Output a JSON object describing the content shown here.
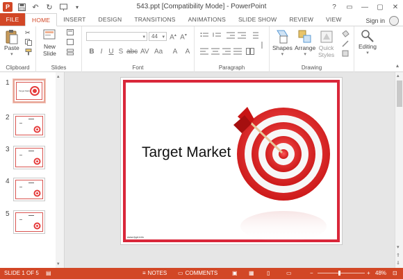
{
  "window": {
    "title": "543.ppt [Compatibility Mode] - PowerPoint",
    "app_logo": "P",
    "controls": [
      "?",
      "▭",
      "—",
      "▢",
      "✕"
    ]
  },
  "tabs": [
    {
      "label": "FILE"
    },
    {
      "label": "HOME"
    },
    {
      "label": "INSERT"
    },
    {
      "label": "DESIGN"
    },
    {
      "label": "TRANSITIONS"
    },
    {
      "label": "ANIMATIONS"
    },
    {
      "label": "SLIDE SHOW"
    },
    {
      "label": "REVIEW"
    },
    {
      "label": "VIEW"
    }
  ],
  "account": {
    "signin_label": "Sign in"
  },
  "ribbon": {
    "clipboard": {
      "paste_label": "Paste",
      "group_label": "Clipboard"
    },
    "slides": {
      "new_slide_label": "New",
      "new_slide_label2": "Slide",
      "group_label": "Slides"
    },
    "font": {
      "font_size": "44",
      "group_label": "Font"
    },
    "paragraph": {
      "group_label": "Paragraph"
    },
    "drawing": {
      "shapes_label": "Shapes",
      "arrange_label": "Arrange",
      "quick_styles_label": "Quick",
      "quick_styles_label2": "Styles",
      "group_label": "Drawing"
    },
    "editing": {
      "editing_label": "Editing"
    }
  },
  "thumbnails": [
    {
      "num": "1",
      "selected": true
    },
    {
      "num": "2",
      "selected": false
    },
    {
      "num": "3",
      "selected": false
    },
    {
      "num": "4",
      "selected": false
    },
    {
      "num": "5",
      "selected": false
    }
  ],
  "slide": {
    "title": "Target Market",
    "footer": "www.fppt.info"
  },
  "status": {
    "slide_counter": "SLIDE 1 OF 5",
    "notes_label": "NOTES",
    "comments_label": "COMMENTS",
    "zoom": "48%"
  },
  "colors": {
    "accent": "#d24726",
    "slide_border": "#d9273a"
  }
}
